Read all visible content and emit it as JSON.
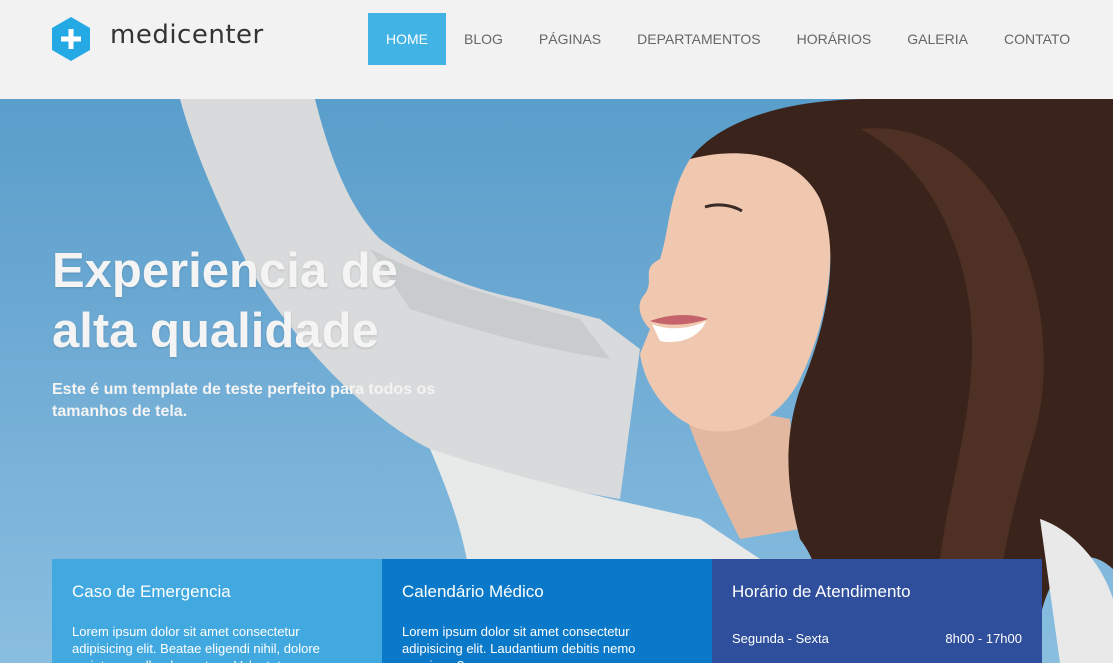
{
  "brand": {
    "name": "medicenter",
    "accent": "#42b3e5"
  },
  "nav": {
    "items": [
      {
        "label": "HOME",
        "active": true
      },
      {
        "label": "BLOG"
      },
      {
        "label": "PÁGINAS"
      },
      {
        "label": "DEPARTAMENTOS"
      },
      {
        "label": "HORÁRIOS"
      },
      {
        "label": "GALERIA"
      },
      {
        "label": "CONTATO"
      }
    ]
  },
  "hero": {
    "title": "Experiencia de alta qualidade",
    "subtitle": "Este é um template de teste perfeito para todos os tamanhos de tela."
  },
  "boxes": [
    {
      "title": "Caso de Emergencia",
      "text": "Lorem ipsum dolor sit amet consectetur adipisicing elit. Beatae eligendi nihil, dolore pariatur repellendus autem. Voluptatum quos",
      "color": "#42a8e0"
    },
    {
      "title": "Calendário Médico",
      "text": "Lorem ipsum dolor sit amet consectetur adipisicing elit. Laudantium debitis nemo possimus?",
      "color": "#0b79c9"
    },
    {
      "title": "Horário de Atendimento",
      "hours": [
        {
          "days": "Segunda - Sexta",
          "time": "8h00 - 17h00"
        }
      ],
      "color": "#2f4f9d"
    }
  ]
}
